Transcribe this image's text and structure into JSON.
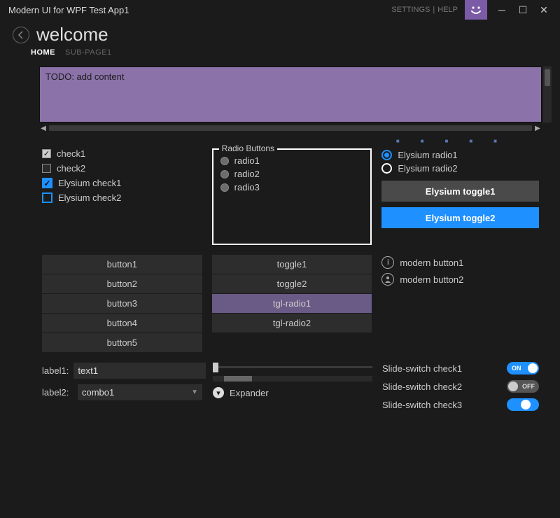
{
  "titlebar": {
    "title": "Modern UI for WPF Test App1",
    "links": {
      "settings": "SETTINGS",
      "sep": "|",
      "help": "HELP"
    }
  },
  "header": {
    "page_title": "welcome",
    "tabs": {
      "home": "HOME",
      "sub": "SUB-PAGE1"
    }
  },
  "todo": "TODO: add content",
  "checks": {
    "c1": "check1",
    "c2": "check2",
    "e1": "Elysium check1",
    "e2": "Elysium check2"
  },
  "radio_group": {
    "legend": "Radio Buttons",
    "r1": "radio1",
    "r2": "radio2",
    "r3": "radio3"
  },
  "eradio": {
    "r1": "Elysium radio1",
    "r2": "Elysium radio2"
  },
  "etoggle": {
    "t1": "Elysium toggle1",
    "t2": "Elysium toggle2"
  },
  "buttons": {
    "b1": "button1",
    "b2": "button2",
    "b3": "button3",
    "b4": "button4",
    "b5": "button5"
  },
  "toggles": {
    "t1": "toggle1",
    "t2": "toggle2",
    "t3": "tgl-radio1",
    "t4": "tgl-radio2"
  },
  "modern": {
    "m1": "modern button1",
    "m2": "modern button2"
  },
  "form": {
    "label1": "label1:",
    "text1": "text1",
    "label2": "label2:",
    "combo1": "combo1"
  },
  "expander": "Expander",
  "switches": {
    "s1_label": "Slide-switch check1",
    "s1_text": "ON",
    "s2_label": "Slide-switch check2",
    "s2_text": "OFF",
    "s3_label": "Slide-switch check3"
  }
}
